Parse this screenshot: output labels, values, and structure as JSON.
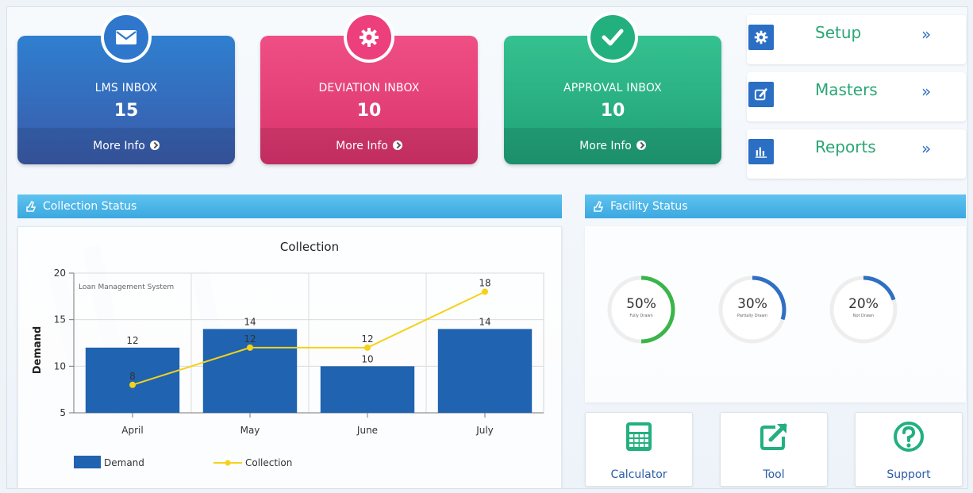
{
  "colors": {
    "lms": "#2f7fd0",
    "deviation": "#ec3f7b",
    "approval": "#22b07f",
    "header": "#3ba8e0",
    "bar": "#1f63b1",
    "line": "#f5d11a",
    "quicklink_text": "#2aa676"
  },
  "cards": {
    "lms": {
      "title": "LMS INBOX",
      "count": "15",
      "more": "More Info",
      "icon": "envelope-icon"
    },
    "deviation": {
      "title": "DEVIATION INBOX",
      "count": "10",
      "more": "More Info",
      "icon": "gear-icon"
    },
    "approval": {
      "title": "APPROVAL INBOX",
      "count": "10",
      "more": "More Info",
      "icon": "check-icon"
    }
  },
  "quicklinks": [
    {
      "label": "Setup",
      "chevron": "»",
      "icon": "gear-icon"
    },
    {
      "label": "Masters",
      "chevron": "»",
      "icon": "edit-icon"
    },
    {
      "label": "Reports",
      "chevron": "»",
      "icon": "bar-chart-icon"
    }
  ],
  "panels": {
    "collection": "Collection Status",
    "facility": "Facility Status"
  },
  "chart_data": {
    "type": "bar",
    "title": "Collection",
    "subtitle": "Loan Management System",
    "xlabel": "",
    "ylabel": "Demand",
    "ylim": [
      5,
      20
    ],
    "yticks": [
      5,
      10,
      15,
      20
    ],
    "categories": [
      "April",
      "May",
      "June",
      "July"
    ],
    "series": [
      {
        "name": "Demand",
        "kind": "bar",
        "values": [
          12,
          14,
          10,
          14
        ]
      },
      {
        "name": "Collection",
        "kind": "line",
        "values": [
          8,
          12,
          12,
          18
        ]
      }
    ],
    "legend": "bottom-left",
    "grid": true
  },
  "facility": [
    {
      "pct": "50%",
      "label": "Fully Drawn",
      "value": 0.5,
      "color": "#3bb54a"
    },
    {
      "pct": "30%",
      "label": "Partially Drawn",
      "value": 0.3,
      "color": "#2f6fc4"
    },
    {
      "pct": "20%",
      "label": "Not Drawn",
      "value": 0.2,
      "color": "#2f6fc4"
    }
  ],
  "tiles": [
    {
      "label": "Calculator",
      "icon": "calculator-icon"
    },
    {
      "label": "Tool",
      "icon": "external-link-icon"
    },
    {
      "label": "Support",
      "icon": "question-icon"
    }
  ]
}
